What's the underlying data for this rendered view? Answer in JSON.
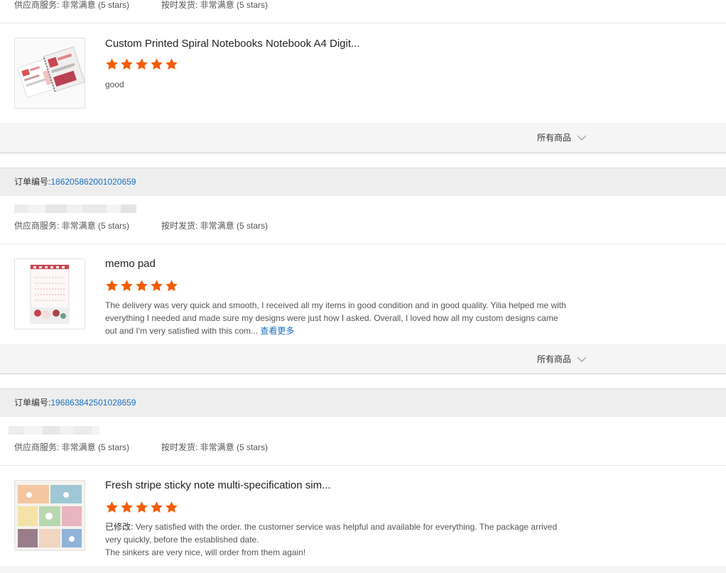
{
  "labels": {
    "supplier_service": "供应商服务: 非常满意",
    "on_time_shipping": "按时发货: 非常满意",
    "stars_text": "(5 stars)",
    "order_no_label": "订单编号:",
    "all_products": "所有商品",
    "see_more": "查看更多",
    "edited_prefix": "已修改:"
  },
  "colors": {
    "star": "#f25c05",
    "link": "#1a6fc0"
  },
  "orders": [
    {
      "products": [
        {
          "title": "Custom Printed Spiral Notebooks Notebook A4 Digit...",
          "rating": 5,
          "review": "good"
        }
      ]
    },
    {
      "order_number": "186205862001020659",
      "products": [
        {
          "title": "memo pad",
          "rating": 5,
          "review": "The delivery was very quick and smooth, I received all my items in good condition and in good quality. Yilia helped me with everything I needed and made sure my designs were just how I asked. Overall, I loved how all my custom designs came out and I'm very satisfied with this com..."
        }
      ]
    },
    {
      "order_number": "196863842501028659",
      "products": [
        {
          "title": "Fresh stripe sticky note multi-specification sim...",
          "rating": 5,
          "review": "Very satisfied with the order. the customer service was helpful and available for everything. The package arrived very quickly, before the established date.",
          "review_line2": "The sinkers are very nice, will order from them again!"
        }
      ]
    }
  ]
}
